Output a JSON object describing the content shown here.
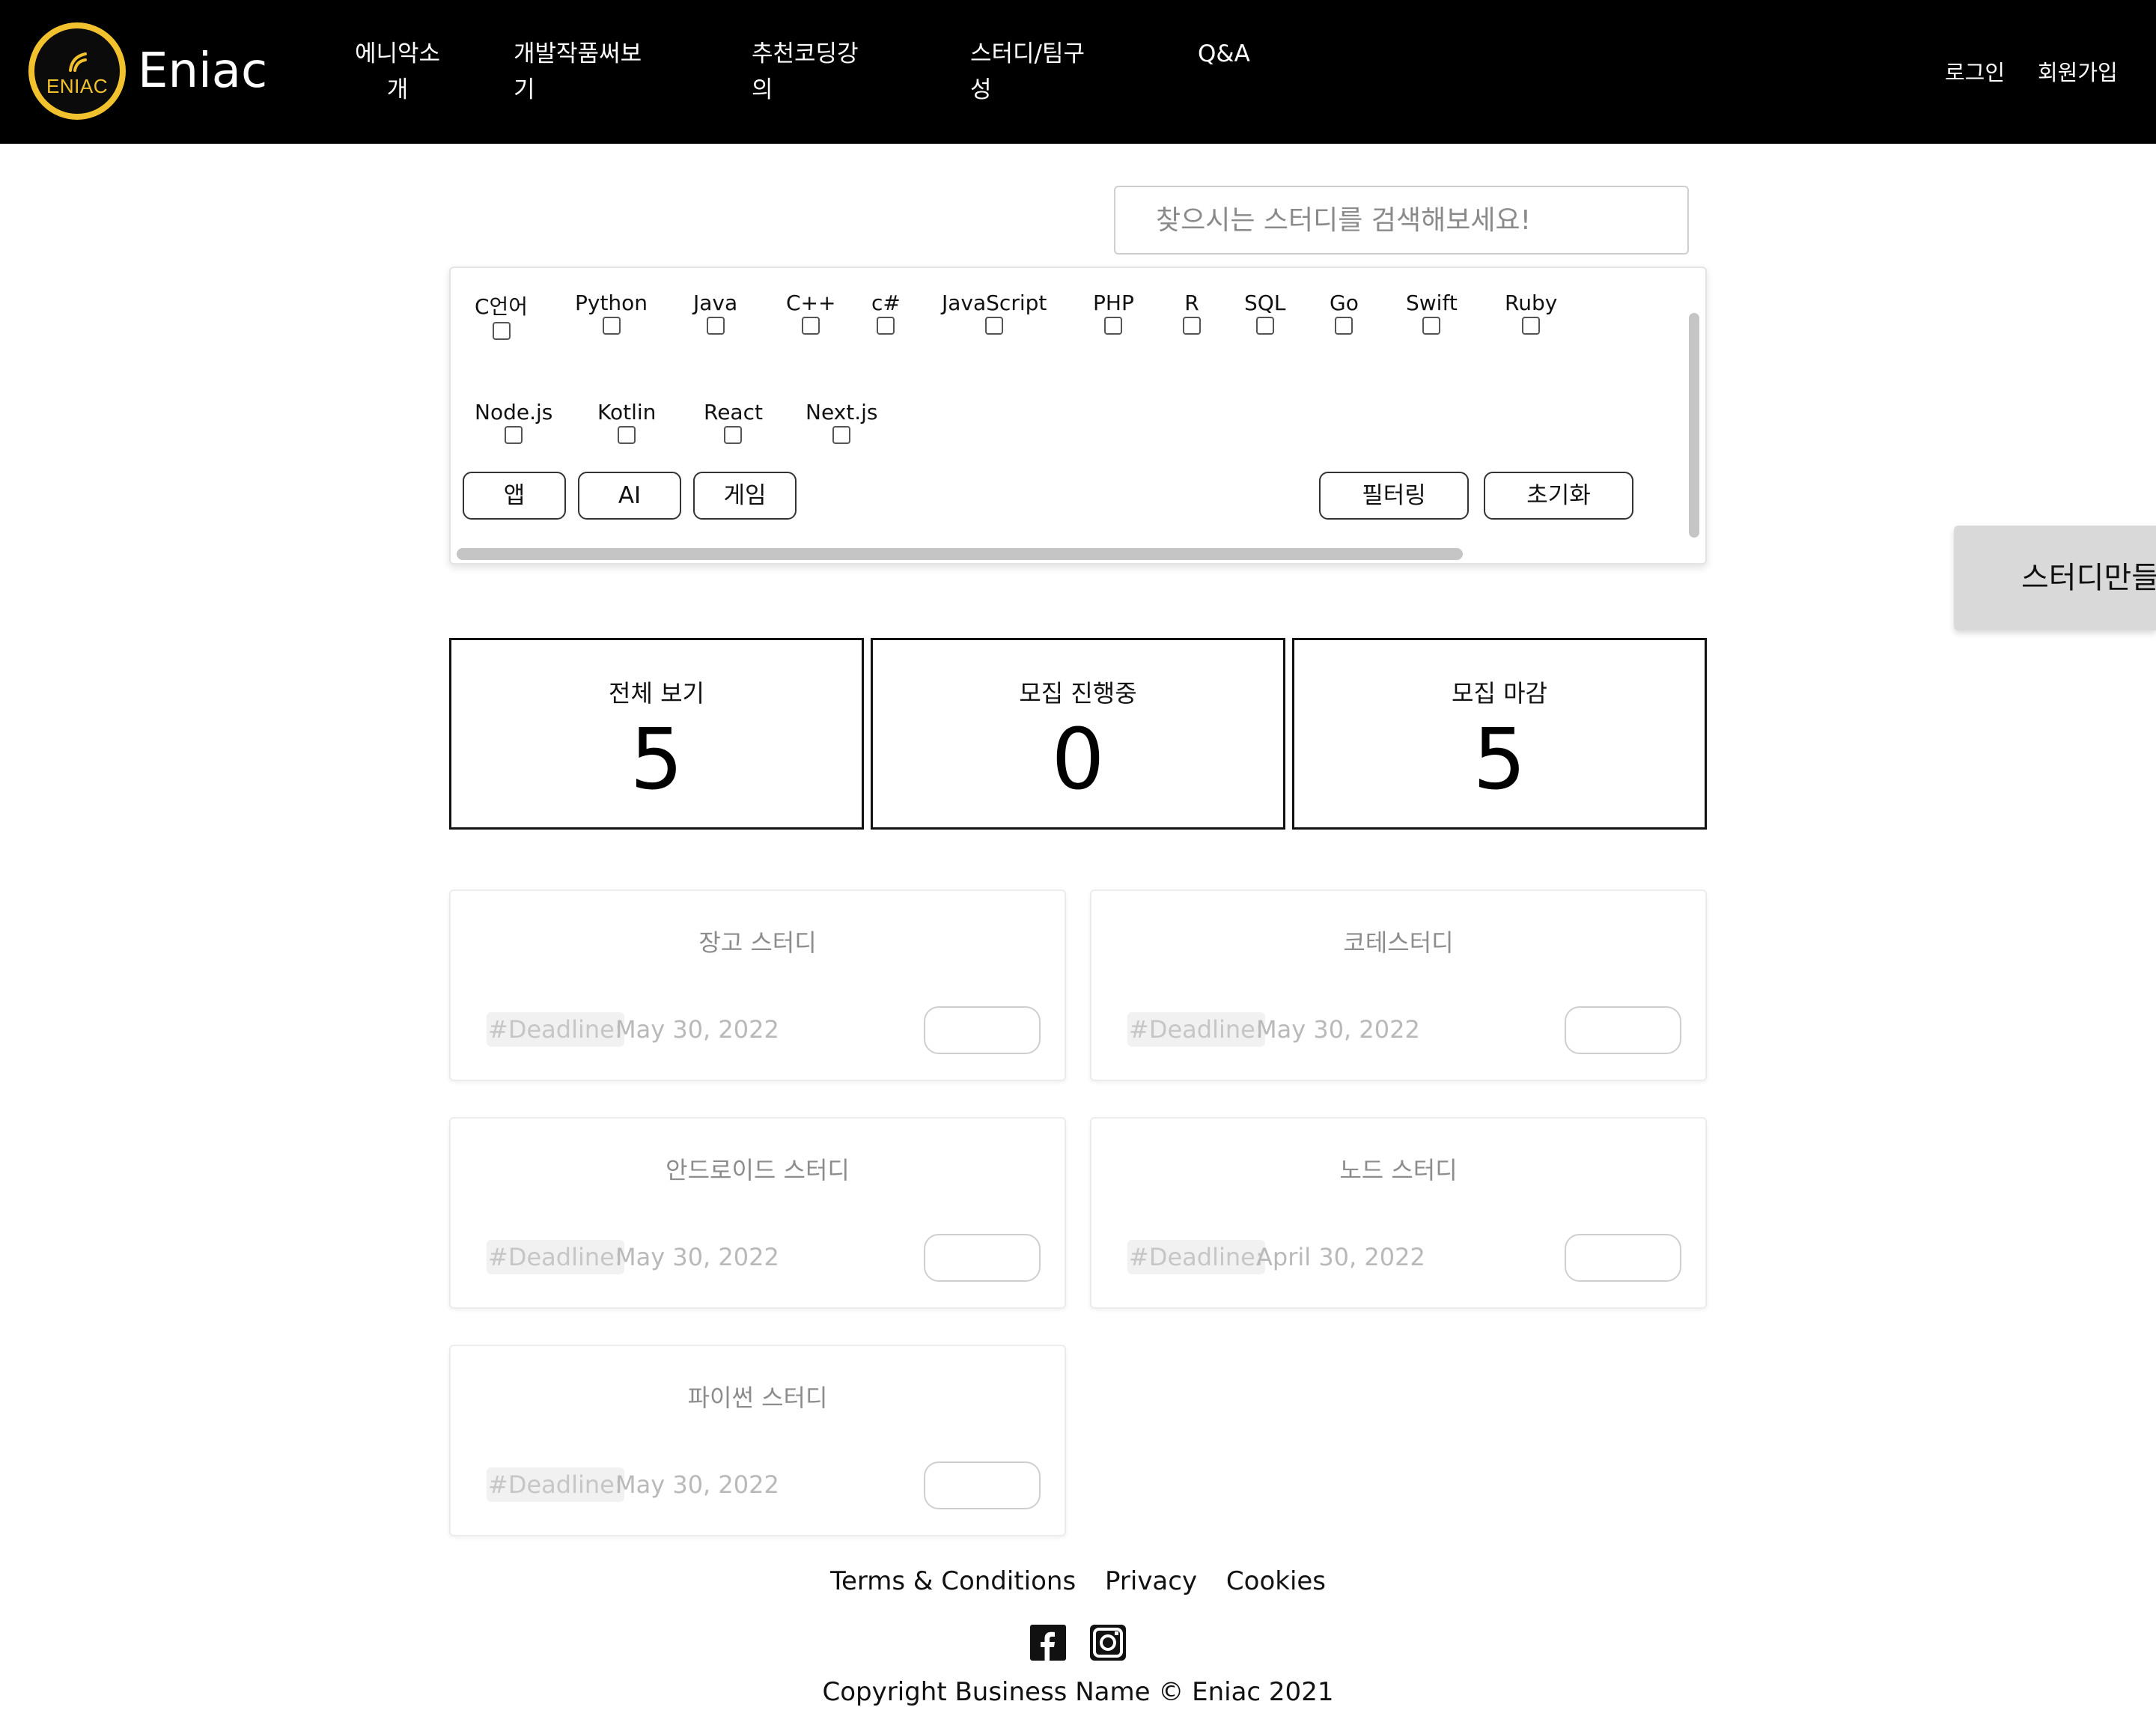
{
  "header": {
    "logo_text": "ENIAC",
    "brand": "Eniac",
    "nav": [
      {
        "line1": "에니악소",
        "line2": "개"
      },
      {
        "line1": "개발작품써보",
        "line2": "기"
      },
      {
        "line1": "추천코딩강",
        "line2": "의"
      },
      {
        "line1": "스터디/팀구",
        "line2": "성"
      },
      {
        "line1": "Q&A",
        "line2": ""
      }
    ],
    "login": "로그인",
    "signup": "회원가입"
  },
  "search": {
    "placeholder": "찾으시는 스터디를 검색해보세요!"
  },
  "filters": {
    "languages": [
      "C언어",
      "Python",
      "Java",
      "C++",
      "c#",
      "JavaScript",
      "PHP",
      "R",
      "SQL",
      "Go",
      "Swift",
      "Ruby",
      "Node.js",
      "Kotlin",
      "React",
      "Next.js"
    ],
    "categories": [
      "앱",
      "AI",
      "게임"
    ],
    "filter_button": "필터링",
    "reset_button": "초기화"
  },
  "make_study_button": "스터디만들기",
  "stats": [
    {
      "label": "전체 보기",
      "value": "5"
    },
    {
      "label": "모집 진행중",
      "value": "0"
    },
    {
      "label": "모집 마감",
      "value": "5"
    }
  ],
  "studies": [
    {
      "title": "장고 스터디",
      "tag": "#Deadline:",
      "date": "May 30, 2022"
    },
    {
      "title": "코테스터디",
      "tag": "#Deadline:",
      "date": "May 30, 2022"
    },
    {
      "title": "안드로이드 스터디",
      "tag": "#Deadline:",
      "date": "May 30, 2022"
    },
    {
      "title": "노드 스터디",
      "tag": "#Deadline:",
      "date": "April 30, 2022"
    },
    {
      "title": "파이썬 스터디",
      "tag": "#Deadline:",
      "date": "May 30, 2022"
    }
  ],
  "footer": {
    "links": [
      "Terms & Conditions",
      "Privacy",
      "Cookies"
    ],
    "social": [
      "facebook-icon",
      "instagram-icon"
    ],
    "copyright": "Copyright Business Name © Eniac 2021"
  },
  "colors": {
    "header_bg": "#000000",
    "logo_gold": "#f2c12e",
    "side_button_bg": "#d9d9d9"
  }
}
